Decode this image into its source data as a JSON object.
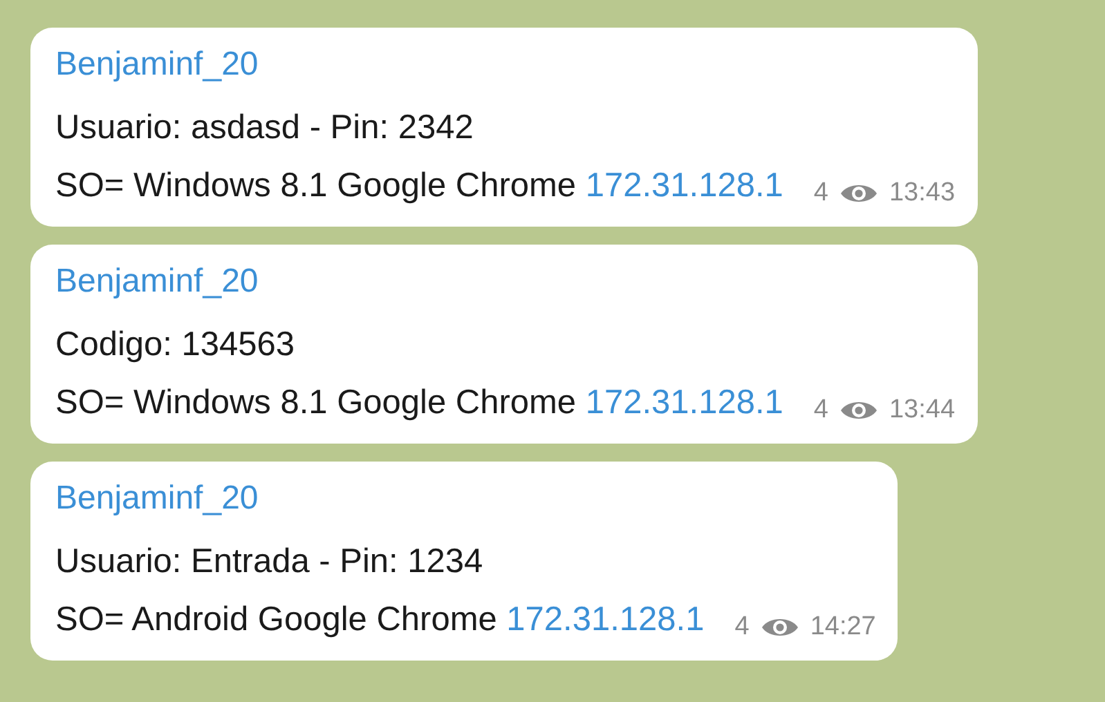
{
  "messages": [
    {
      "sender": "Benjaminf_20",
      "text": "Usuario: asdasd - Pin: 2342",
      "device": "SO= Windows 8.1 Google Chrome",
      "ip": "172.31.128.1",
      "views": "4",
      "time": "13:43"
    },
    {
      "sender": "Benjaminf_20",
      "text": "Codigo: 134563",
      "device": "SO= Windows 8.1 Google Chrome",
      "ip": "172.31.128.1",
      "views": "4",
      "time": "13:44"
    },
    {
      "sender": "Benjaminf_20",
      "text": "Usuario: Entrada - Pin: 1234",
      "device": "SO= Android Google Chrome",
      "ip": "172.31.128.1",
      "views": "4",
      "time": "14:27"
    }
  ]
}
